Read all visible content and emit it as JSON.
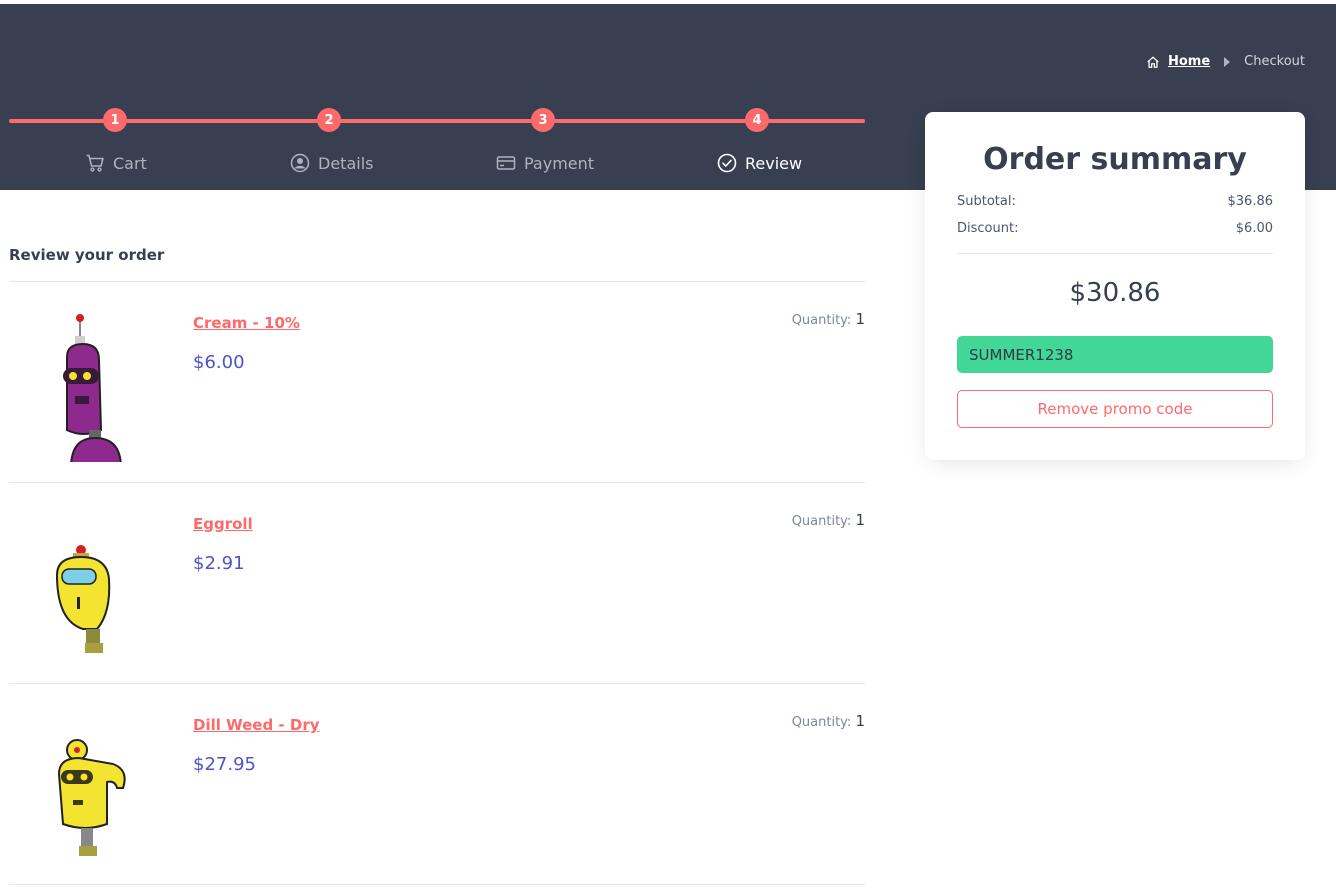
{
  "breadcrumb": {
    "home": "Home",
    "current": "Checkout"
  },
  "steps": [
    {
      "num": "1",
      "label": "Cart"
    },
    {
      "num": "2",
      "label": "Details"
    },
    {
      "num": "3",
      "label": "Payment"
    },
    {
      "num": "4",
      "label": "Review"
    }
  ],
  "review": {
    "title": "Review your order",
    "quantity_label": "Quantity:",
    "items": [
      {
        "name": "Cream - 10%",
        "price": "$6.00",
        "qty": "1"
      },
      {
        "name": "Eggroll",
        "price": "$2.91",
        "qty": "1"
      },
      {
        "name": "Dill Weed - Dry",
        "price": "$27.95",
        "qty": "1"
      }
    ]
  },
  "summary": {
    "title": "Order summary",
    "subtotal_label": "Subtotal:",
    "subtotal": "$36.86",
    "discount_label": "Discount:",
    "discount": "$6.00",
    "total": "$30.86",
    "promo_code": "SUMMER1238",
    "remove_label": "Remove promo code"
  },
  "colors": {
    "accent": "#fe696a",
    "header": "#373f50",
    "promo": "#42d697",
    "price": "#4e54c8"
  },
  "icons": [
    "home-icon",
    "chevron-right-icon",
    "cart-icon",
    "user-circle-icon",
    "credit-card-icon",
    "check-circle-icon"
  ]
}
